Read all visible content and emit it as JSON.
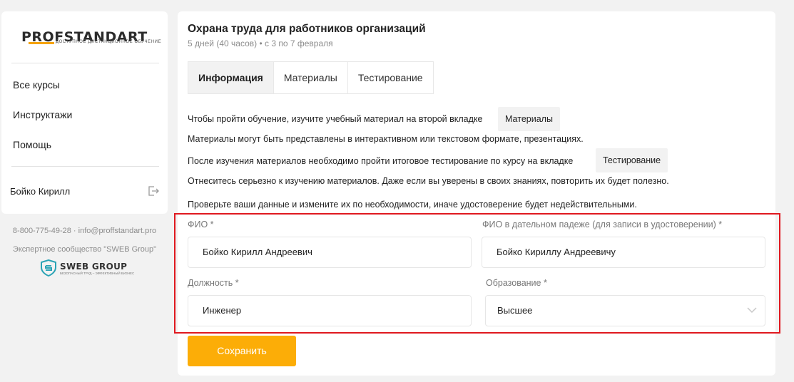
{
  "sidebar": {
    "logo": {
      "title": "PROFSTANDART",
      "subtitle": "доступное дистанционное обучение"
    },
    "nav": [
      {
        "label": "Все курсы"
      },
      {
        "label": "Инструктажи"
      },
      {
        "label": "Помощь"
      }
    ],
    "user_name": "Бойко Кирилл",
    "contact": "8-800-775-49-28 · info@proffstandart.pro",
    "community": "Экспертное сообщество \"SWEB Group\"",
    "sweb_logo": {
      "title": "SWEB GROUP",
      "subtitle": "безопасный труд – эффективный бизнес"
    }
  },
  "course": {
    "title": "Охрана труда для работников организаций",
    "subtitle": "5 дней (40 часов) • с 3 по 7 февраля"
  },
  "tabs": [
    {
      "label": "Информация",
      "active": true
    },
    {
      "label": "Материалы",
      "active": false
    },
    {
      "label": "Тестирование",
      "active": false
    }
  ],
  "info": {
    "line1": "Чтобы пройти обучение, изучите учебный материал на второй вкладке",
    "chip1": "Материалы",
    "line2": "Материалы могут быть представлены в интерактивном или текстовом формате, презентациях.",
    "line3": "После изучения материалов необходимо пройти итоговое тестирование по курсу на вкладке",
    "chip2": "Тестирование",
    "line4": "Отнеситесь серьезно к изучению материалов. Даже если вы уверены в своих знаниях, повторить их будет полезно.",
    "line5": "Проверьте ваши данные и измените их по необходимости, иначе удостоверение будет недействительными."
  },
  "form": {
    "fio": {
      "label": "ФИО *",
      "value": "Бойко Кирилл Андреевич"
    },
    "fio_dative": {
      "label": "ФИО в дательном падеже (для записи в удостоверении) *",
      "value": "Бойко Кириллу Андреевичу"
    },
    "position": {
      "label": "Должность *",
      "value": "Инженер"
    },
    "education": {
      "label": "Образование *",
      "value": "Высшее"
    },
    "save_label": "Сохранить"
  },
  "colors": {
    "accent": "#fcad07",
    "highlight": "#e0191f",
    "background": "#f2f2f2"
  }
}
